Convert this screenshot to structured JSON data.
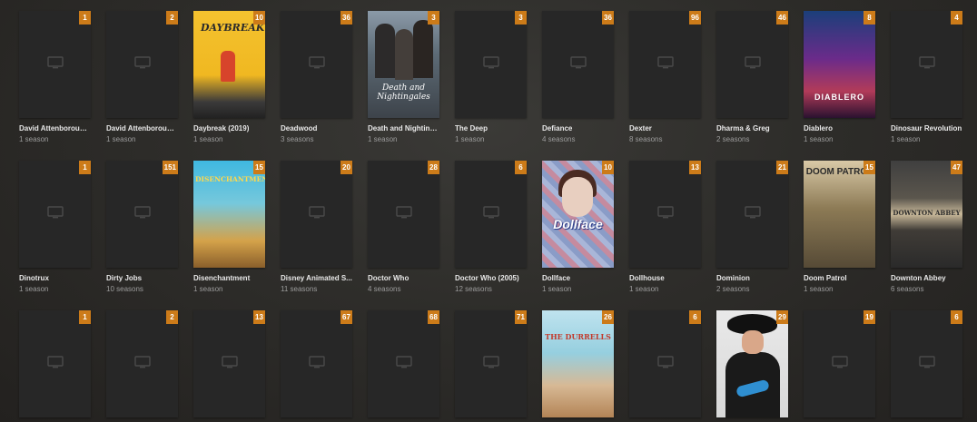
{
  "colors": {
    "badge": "#cc7b19",
    "title": "#e8e8e8",
    "subtitle": "#9c9c9c"
  },
  "rows": [
    [
      {
        "title": "David Attenborough...",
        "sub": "1 season",
        "badge": "1",
        "art": "none"
      },
      {
        "title": "David Attenborough...",
        "sub": "1 season",
        "badge": "2",
        "art": "none"
      },
      {
        "title": "Daybreak (2019)",
        "sub": "1 season",
        "badge": "10",
        "art": "daybreak",
        "art_text": "DAYBREAK"
      },
      {
        "title": "Deadwood",
        "sub": "3 seasons",
        "badge": "36",
        "art": "none"
      },
      {
        "title": "Death and Nighting...",
        "sub": "1 season",
        "badge": "3",
        "art": "death",
        "art_text": "Death and Nightingales"
      },
      {
        "title": "The Deep",
        "sub": "1 season",
        "badge": "3",
        "art": "none"
      },
      {
        "title": "Defiance",
        "sub": "4 seasons",
        "badge": "36",
        "art": "none"
      },
      {
        "title": "Dexter",
        "sub": "8 seasons",
        "badge": "96",
        "art": "none"
      },
      {
        "title": "Dharma & Greg",
        "sub": "2 seasons",
        "badge": "46",
        "art": "none"
      },
      {
        "title": "Diablero",
        "sub": "1 season",
        "badge": "8",
        "art": "diablero",
        "art_text": "DIABLERO"
      },
      {
        "title": "Dinosaur Revolution",
        "sub": "1 season",
        "badge": "4",
        "art": "none"
      }
    ],
    [
      {
        "title": "Dinotrux",
        "sub": "1 season",
        "badge": "1",
        "art": "none"
      },
      {
        "title": "Dirty Jobs",
        "sub": "10 seasons",
        "badge": "151",
        "art": "none"
      },
      {
        "title": "Disenchantment",
        "sub": "1 season",
        "badge": "15",
        "art": "disench",
        "art_text": "DISENCHANTMENT"
      },
      {
        "title": "Disney Animated S...",
        "sub": "11 seasons",
        "badge": "20",
        "art": "none"
      },
      {
        "title": "Doctor Who",
        "sub": "4 seasons",
        "badge": "28",
        "art": "none"
      },
      {
        "title": "Doctor Who (2005)",
        "sub": "12 seasons",
        "badge": "6",
        "art": "none"
      },
      {
        "title": "Dollface",
        "sub": "1 season",
        "badge": "10",
        "art": "dollface",
        "art_text": "Dollface"
      },
      {
        "title": "Dollhouse",
        "sub": "1 season",
        "badge": "13",
        "art": "none"
      },
      {
        "title": "Dominion",
        "sub": "2 seasons",
        "badge": "21",
        "art": "none"
      },
      {
        "title": "Doom Patrol",
        "sub": "1 season",
        "badge": "15",
        "art": "doom",
        "art_text": "DOOM PATROL"
      },
      {
        "title": "Downton Abbey",
        "sub": "6 seasons",
        "badge": "47",
        "art": "downton",
        "art_text": "DOWNTON ABBEY"
      }
    ],
    [
      {
        "title": "",
        "sub": "",
        "badge": "1",
        "art": "none"
      },
      {
        "title": "",
        "sub": "",
        "badge": "2",
        "art": "none"
      },
      {
        "title": "",
        "sub": "",
        "badge": "13",
        "art": "none"
      },
      {
        "title": "",
        "sub": "",
        "badge": "67",
        "art": "none"
      },
      {
        "title": "",
        "sub": "",
        "badge": "68",
        "art": "none"
      },
      {
        "title": "",
        "sub": "",
        "badge": "71",
        "art": "none"
      },
      {
        "title": "",
        "sub": "",
        "badge": "26",
        "art": "durrells",
        "art_text": "THE DURRELLS"
      },
      {
        "title": "",
        "sub": "",
        "badge": "6",
        "art": "none"
      },
      {
        "title": "",
        "sub": "",
        "badge": "29",
        "art": "eastbound"
      },
      {
        "title": "",
        "sub": "",
        "badge": "19",
        "art": "none"
      },
      {
        "title": "",
        "sub": "",
        "badge": "6",
        "art": "none"
      }
    ]
  ]
}
